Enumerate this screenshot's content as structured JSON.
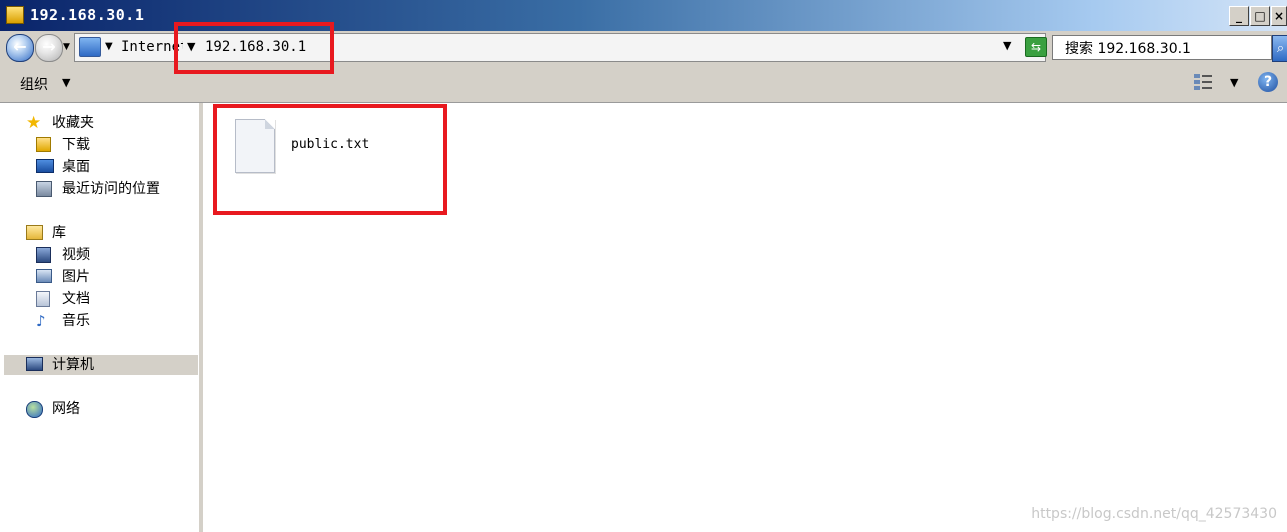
{
  "window": {
    "title": "192.168.30.1",
    "minimize_label": "_",
    "maximize_label": "□",
    "close_label": "×"
  },
  "address_bar": {
    "back_label": "←",
    "forward_label": "→",
    "prefix": "Internet",
    "path": "192.168.30.1",
    "separator": "▼",
    "dropdown": "▼",
    "refresh_label": "⇆"
  },
  "search": {
    "text": "搜索 192.168.30.1",
    "button": "⌕"
  },
  "toolbar": {
    "organize_label": "组织",
    "organize_arrow": "▼",
    "view_arrow": "▼",
    "help_label": "?"
  },
  "sidebar": {
    "favorites": {
      "label": "收藏夹",
      "items": [
        {
          "label": "下载",
          "icon": "download-folder-icon"
        },
        {
          "label": "桌面",
          "icon": "desktop-icon"
        },
        {
          "label": "最近访问的位置",
          "icon": "recent-places-icon"
        }
      ]
    },
    "libraries": {
      "label": "库",
      "items": [
        {
          "label": "视频",
          "icon": "video-icon"
        },
        {
          "label": "图片",
          "icon": "pictures-icon"
        },
        {
          "label": "文档",
          "icon": "documents-icon"
        },
        {
          "label": "音乐",
          "icon": "music-icon"
        }
      ]
    },
    "computer": {
      "label": "计算机",
      "selected": true
    },
    "network": {
      "label": "网络"
    }
  },
  "content": {
    "files": [
      {
        "name": "public.txt",
        "icon": "text-file-icon"
      }
    ]
  },
  "watermark": "https://blog.csdn.net/qq_42573430",
  "colors": {
    "highlight_red": "#e8191f",
    "titlebar_blue": "#0a246a",
    "chrome_gray": "#d4d0c8"
  }
}
